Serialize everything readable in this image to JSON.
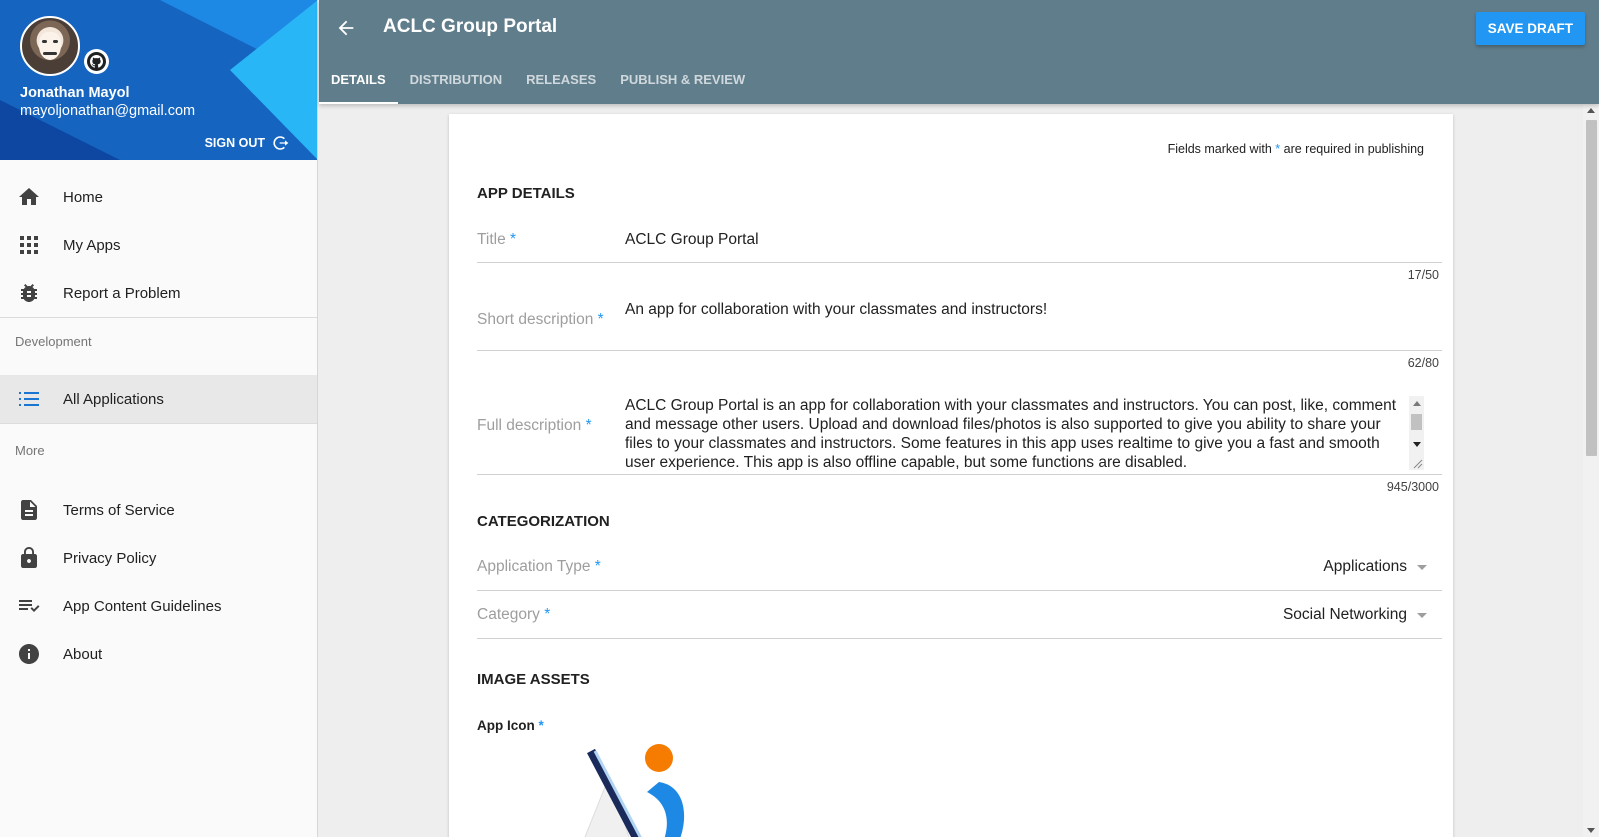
{
  "colors": {
    "header": "#607d8b",
    "accent": "#2196f3",
    "profile_bg": "#1565c0",
    "required_star": "#2196f3"
  },
  "profile": {
    "name": "Jonathan Mayol",
    "email": "mayoljonathan@gmail.com",
    "signout_label": "SIGN OUT"
  },
  "nav": {
    "main_items": [
      {
        "label": "Home",
        "icon": "home-icon"
      },
      {
        "label": "My Apps",
        "icon": "apps-grid-icon"
      },
      {
        "label": "Report a Problem",
        "icon": "bug-icon"
      }
    ],
    "development_header": "Development",
    "development_items": [
      {
        "label": "All Applications",
        "icon": "list-icon",
        "active": true
      }
    ],
    "more_header": "More",
    "more_items": [
      {
        "label": "Terms of Service",
        "icon": "document-icon"
      },
      {
        "label": "Privacy Policy",
        "icon": "lock-icon"
      },
      {
        "label": "App Content Guidelines",
        "icon": "playlist-check-icon"
      },
      {
        "label": "About",
        "icon": "info-icon"
      }
    ]
  },
  "header": {
    "title": "ACLC Group Portal",
    "save_label": "SAVE DRAFT",
    "tabs": [
      {
        "label": "DETAILS",
        "active": true
      },
      {
        "label": "DISTRIBUTION"
      },
      {
        "label": "RELEASES"
      },
      {
        "label": "PUBLISH & REVIEW"
      }
    ]
  },
  "form": {
    "required_note_before": "Fields marked with",
    "required_star": "*",
    "required_note_after": "are required in publishing",
    "app_details_title": "APP DETAILS",
    "title_label": "Title",
    "title_value": "ACLC Group Portal",
    "title_counter": "17/50",
    "short_label": "Short description",
    "short_value": "An app for collaboration with your classmates and instructors!",
    "short_counter": "62/80",
    "full_label": "Full description",
    "full_value": "ACLC Group Portal is an app for collaboration with your classmates and instructors. You can post, like, comment and message other users. Upload and download files/photos is also supported to give you ability to share your files to your classmates and instructors. Some features in this app uses realtime to give you a fast and smooth user experience. This app is also offline capable, but some functions are disabled.",
    "full_counter": "945/3000",
    "categorization_title": "CATEGORIZATION",
    "app_type_label": "Application Type",
    "app_type_value": "Applications",
    "category_label": "Category",
    "category_value": "Social Networking",
    "image_assets_title": "IMAGE ASSETS",
    "app_icon_label": "App Icon"
  }
}
